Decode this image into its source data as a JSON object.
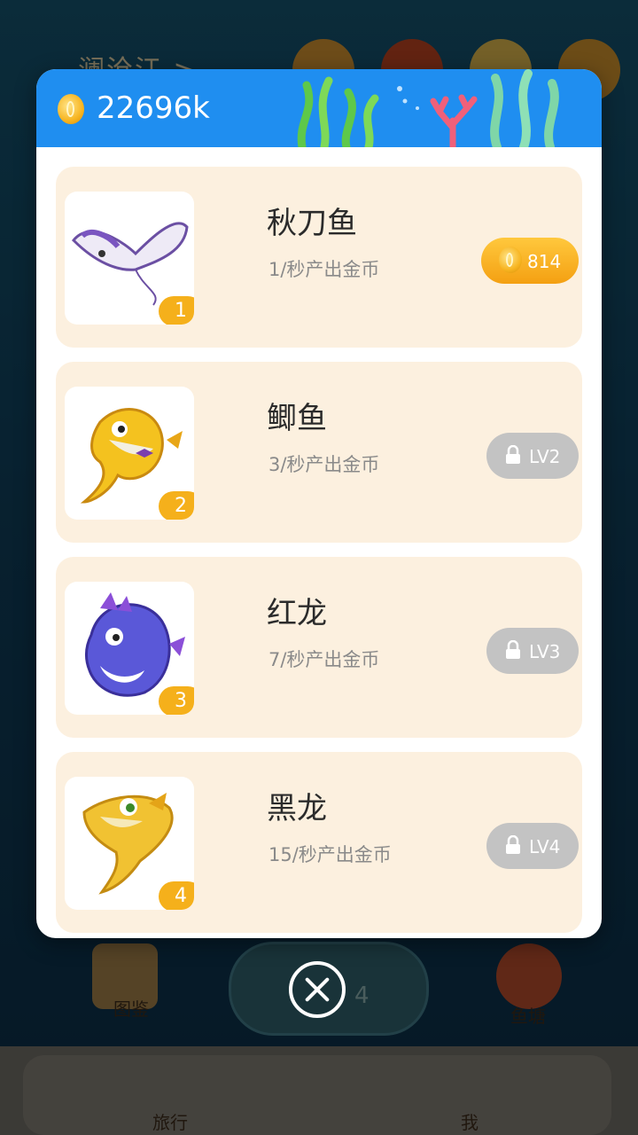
{
  "background": {
    "top_title": "澜沧江 >",
    "nav_left_label": "图鉴",
    "nav_right_label": "鱼塘",
    "progress_number": "4",
    "tab_travel": "旅行",
    "tab_me": "我"
  },
  "modal": {
    "coin_total": "22696k",
    "items": [
      {
        "name": "秋刀鱼",
        "rate": "1/秒产出金币",
        "level": "1",
        "action_type": "buy",
        "price": "814"
      },
      {
        "name": "鲫鱼",
        "rate": "3/秒产出金币",
        "level": "2",
        "action_type": "locked",
        "lock_label": "LV2"
      },
      {
        "name": "红龙",
        "rate": "7/秒产出金币",
        "level": "3",
        "action_type": "locked",
        "lock_label": "LV3"
      },
      {
        "name": "黑龙",
        "rate": "15/秒产出金币",
        "level": "4",
        "action_type": "locked",
        "lock_label": "LV4"
      }
    ]
  },
  "colors": {
    "header_blue": "#1f8ef0",
    "card_bg": "#fcf0df",
    "badge_orange": "#f5b01b",
    "lock_gray": "#c3c3c3"
  },
  "icons": [
    "coin-icon",
    "lock-icon",
    "close-icon"
  ]
}
